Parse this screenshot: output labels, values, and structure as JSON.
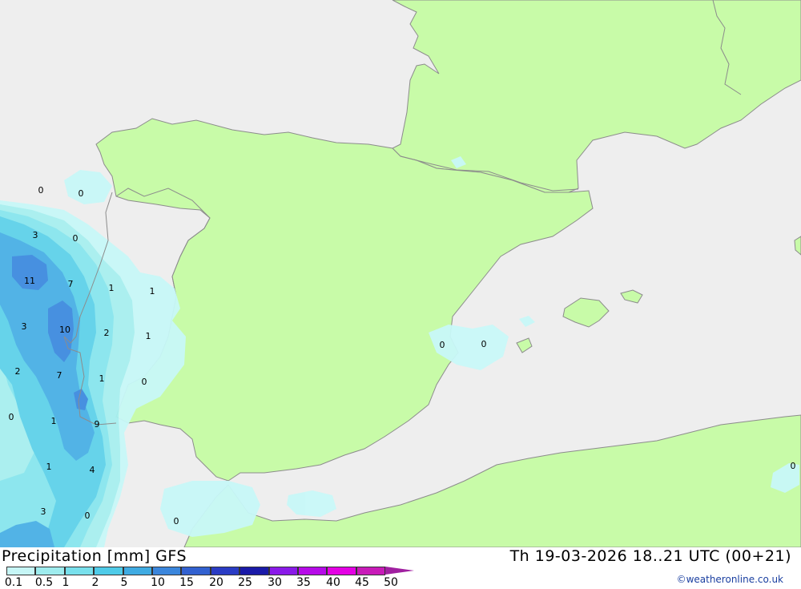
{
  "title": {
    "left": "Precipitation [mm] GFS",
    "right": "Th 19-03-2026 18..21 UTC (00+21)"
  },
  "credit": "©weatheronline.co.uk",
  "colors": {
    "sea": "#eeeeee",
    "land": "#c8fba8",
    "border": "#8c8c8c",
    "precip_0_1": "#c8f8f8",
    "precip_0_5": "#a8f0f0",
    "precip_1": "#88e6ee",
    "precip_2": "#5fd2ea",
    "precip_5": "#4ab0e6",
    "precip_10": "#3f8ce0"
  },
  "legend": {
    "ticks": [
      "0.1",
      "0.5",
      "1",
      "2",
      "5",
      "10",
      "15",
      "20",
      "25",
      "30",
      "35",
      "40",
      "45",
      "50"
    ],
    "colors": [
      "#c6f6f6",
      "#9eecee",
      "#78e0ec",
      "#4fcbe8",
      "#3fabe2",
      "#3b86dc",
      "#3261d0",
      "#2a3cc4",
      "#1a1aa8",
      "#8a1ae8",
      "#b60ae8",
      "#e400e4",
      "#c81ab8",
      "#a020a0"
    ]
  },
  "precip_labels": [
    {
      "text": "0"
    },
    {
      "text": "0"
    },
    {
      "text": "3"
    },
    {
      "text": "0"
    },
    {
      "text": "11"
    },
    {
      "text": "7"
    },
    {
      "text": "1"
    },
    {
      "text": "1"
    },
    {
      "text": "3"
    },
    {
      "text": "10"
    },
    {
      "text": "2"
    },
    {
      "text": "1"
    },
    {
      "text": "2"
    },
    {
      "text": "7"
    },
    {
      "text": "1"
    },
    {
      "text": "0"
    },
    {
      "text": "0"
    },
    {
      "text": "1"
    },
    {
      "text": "9"
    },
    {
      "text": "1"
    },
    {
      "text": "4"
    },
    {
      "text": "3"
    },
    {
      "text": "0"
    },
    {
      "text": "0"
    },
    {
      "text": "0"
    },
    {
      "text": "0"
    },
    {
      "text": "0"
    }
  ]
}
